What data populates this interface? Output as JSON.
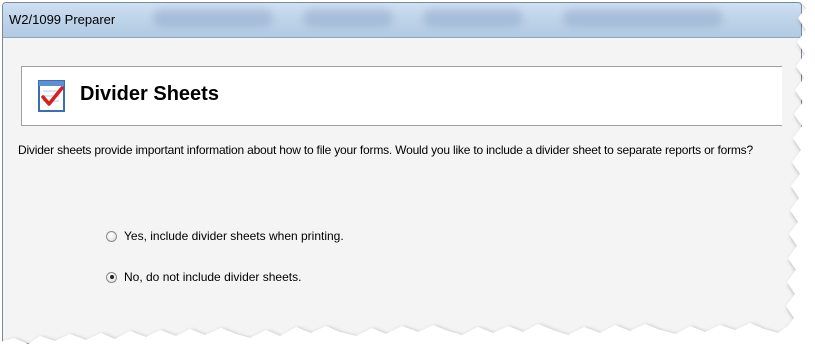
{
  "window": {
    "title": "W2/1099 Preparer"
  },
  "header": {
    "title": "Divider Sheets",
    "icon": "checklist-document-icon"
  },
  "description": "Divider sheets provide important information about how to file your forms. Would you like to include a divider sheet to separate reports or forms?",
  "options": [
    {
      "label": "Yes, include divider sheets when printing.",
      "selected": false
    },
    {
      "label": "No, do not include divider sheets.",
      "selected": true
    }
  ]
}
